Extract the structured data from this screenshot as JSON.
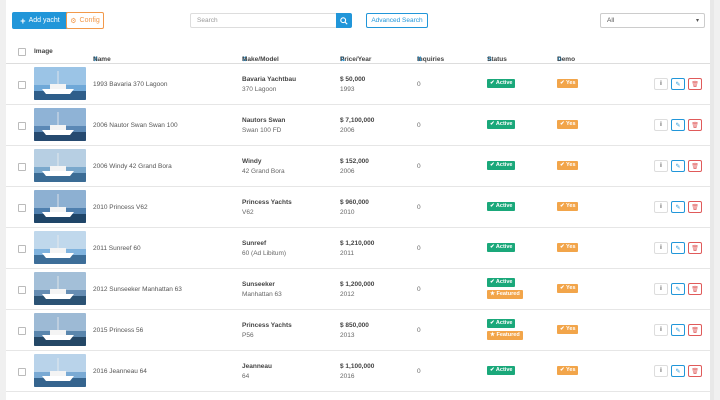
{
  "toolbar": {
    "add_label": "Add yacht",
    "config_label": "Config",
    "search_placeholder": "Search",
    "advanced_label": "Advanced Search",
    "filter_value": "All"
  },
  "columns": {
    "image": "Image",
    "name": "Name",
    "make": "Make/Model",
    "price": "Price/Year",
    "inquiries": "Inquiries",
    "status": "Status",
    "demo": "Demo"
  },
  "colors": {
    "primary": "#2196d9",
    "active": "#1aa87a",
    "featured": "#f2a54a",
    "delete": "#e05a5a"
  },
  "icons": {
    "add": "plus-icon",
    "config": "gear-icon",
    "search": "search-icon",
    "info": "info-icon",
    "edit": "pencil-icon",
    "delete": "trash-icon",
    "sort": "sort-icon",
    "select": "chevron-down-icon"
  },
  "rows": [
    {
      "name": "1993 Bavaria 370 Lagoon",
      "make": "Bavaria Yachtbau",
      "model": "370 Lagoon",
      "price": "$ 50,000",
      "year": "1993",
      "inquiries": "0",
      "status": [
        "Active"
      ],
      "demo": "Yes"
    },
    {
      "name": "2006 Nautor Swan Swan 100",
      "make": "Nautors Swan",
      "model": "Swan 100 FD",
      "price": "$ 7,100,000",
      "year": "2006",
      "inquiries": "0",
      "status": [
        "Active"
      ],
      "demo": "Yes"
    },
    {
      "name": "2006 Windy 42 Grand Bora",
      "make": "Windy",
      "model": "42 Grand Bora",
      "price": "$ 152,000",
      "year": "2006",
      "inquiries": "0",
      "status": [
        "Active"
      ],
      "demo": "Yes"
    },
    {
      "name": "2010 Princess V62",
      "make": "Princess Yachts",
      "model": "V62",
      "price": "$ 960,000",
      "year": "2010",
      "inquiries": "0",
      "status": [
        "Active"
      ],
      "demo": "Yes"
    },
    {
      "name": "2011 Sunreef 60",
      "make": "Sunreef",
      "model": "60 (Ad Libitum)",
      "price": "$ 1,210,000",
      "year": "2011",
      "inquiries": "0",
      "status": [
        "Active"
      ],
      "demo": "Yes"
    },
    {
      "name": "2012 Sunseeker Manhattan 63",
      "make": "Sunseeker",
      "model": "Manhattan 63",
      "price": "$ 1,200,000",
      "year": "2012",
      "inquiries": "0",
      "status": [
        "Active",
        "Featured"
      ],
      "demo": "Yes"
    },
    {
      "name": "2015 Princess 56",
      "make": "Princess Yachts",
      "model": "P56",
      "price": "$ 850,000",
      "year": "2013",
      "inquiries": "0",
      "status": [
        "Active",
        "Featured"
      ],
      "demo": "Yes"
    },
    {
      "name": "2016 Jeanneau 64",
      "make": "Jeanneau",
      "model": "64",
      "price": "$ 1,100,000",
      "year": "2016",
      "inquiries": "0",
      "status": [
        "Active"
      ],
      "demo": "Yes"
    }
  ]
}
